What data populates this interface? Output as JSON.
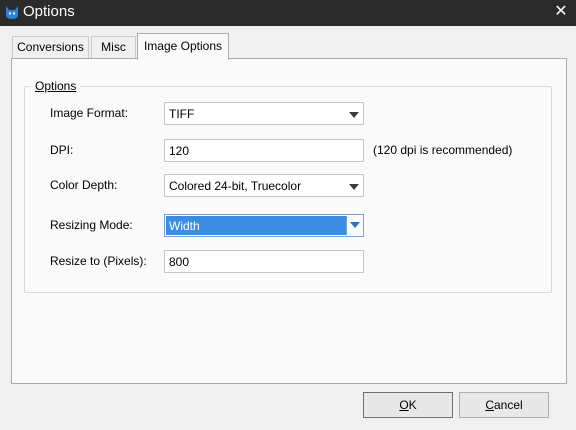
{
  "window": {
    "title": "Options",
    "icon": "cat-app-icon",
    "close_glyph": "✕"
  },
  "tabs": [
    {
      "label": "Conversions"
    },
    {
      "label": "Misc"
    },
    {
      "label": "Image Options",
      "active": true
    }
  ],
  "options_group": {
    "legend": "Options",
    "image_format": {
      "label": "Image Format:",
      "value": "TIFF"
    },
    "dpi": {
      "label": "DPI:",
      "value": "120",
      "hint": "(120 dpi is recommended)"
    },
    "color_depth": {
      "label": "Color Depth:",
      "value": "Colored 24-bit, Truecolor"
    },
    "resizing_mode": {
      "label": "Resizing Mode:",
      "value": "Width"
    },
    "resize_to": {
      "label": "Resize to (Pixels):",
      "value": "800"
    }
  },
  "buttons": {
    "ok": {
      "underline": "O",
      "rest": "K"
    },
    "cancel": {
      "underline": "C",
      "rest": "ancel"
    }
  },
  "colors": {
    "titlebar": "#2b2b2b",
    "selection": "#3b8de3",
    "dialog_bg": "#f0f0f0"
  }
}
